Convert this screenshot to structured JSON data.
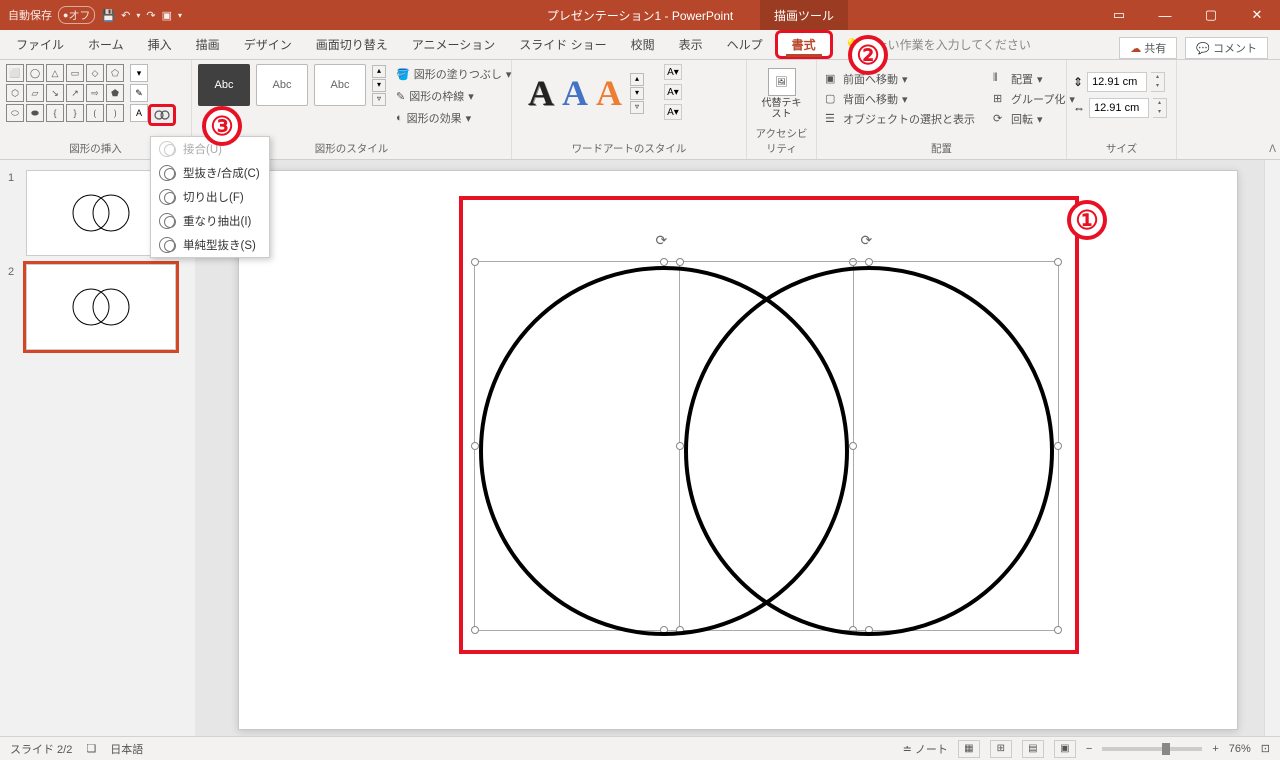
{
  "titlebar": {
    "autosave_label": "自動保存",
    "autosave_state": "オフ",
    "doc_title": "プレゼンテーション1 - PowerPoint",
    "tool_tab": "描画ツール"
  },
  "menu": {
    "tabs": [
      "ファイル",
      "ホーム",
      "挿入",
      "描画",
      "デザイン",
      "画面切り替え",
      "アニメーション",
      "スライド ショー",
      "校閲",
      "表示",
      "ヘルプ"
    ],
    "format_tab": "書式",
    "tellme_placeholder": "したい作業を入力してください",
    "share": "共有",
    "comment": "コメント"
  },
  "ribbon": {
    "groups": {
      "insert_shapes": "図形の挿入",
      "shape_styles": "図形のスタイル",
      "wordart_styles": "ワードアートのスタイル",
      "accessibility": "アクセシビリティ",
      "arrange": "配置",
      "size": "サイズ"
    },
    "style_sample": "Abc",
    "fill": "図形の塗りつぶし",
    "outline": "図形の枠線",
    "effects": "図形の効果",
    "alt_text": "代替テキスト",
    "bring_forward": "前面へ移動",
    "send_backward": "背面へ移動",
    "selection_pane": "オブジェクトの選択と表示",
    "align": "配置",
    "group": "グループ化",
    "rotate": "回転",
    "height": "12.91 cm",
    "width": "12.91 cm"
  },
  "merge_menu": {
    "items": [
      {
        "label": "接合(U)",
        "enabled": false
      },
      {
        "label": "型抜き/合成(C)",
        "enabled": true
      },
      {
        "label": "切り出し(F)",
        "enabled": true
      },
      {
        "label": "重なり抽出(I)",
        "enabled": true
      },
      {
        "label": "単純型抜き(S)",
        "enabled": true
      }
    ]
  },
  "slides": {
    "count": 2,
    "selected": 2
  },
  "status": {
    "slide_indicator": "スライド 2/2",
    "language": "日本語",
    "notes": "ノート",
    "zoom": "76%"
  },
  "callouts": {
    "c1": "①",
    "c2": "②",
    "c3": "③"
  }
}
